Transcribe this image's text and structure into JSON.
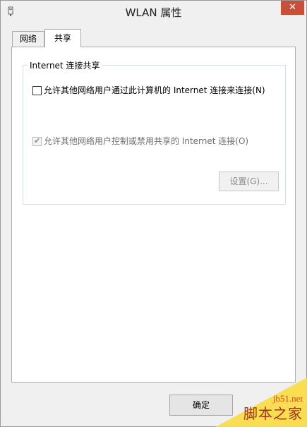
{
  "window": {
    "title": "WLAN 属性",
    "close_label": "✕"
  },
  "tabs": [
    {
      "label": "网络",
      "active": false
    },
    {
      "label": "共享",
      "active": true
    }
  ],
  "sharing": {
    "group_label": "Internet 连接共享",
    "allow_share": {
      "label": "允许其他网络用户通过此计算机的 Internet 连接来连接(N)",
      "checked": false,
      "enabled": true
    },
    "allow_control": {
      "label": "允许其他网络用户控制或禁用共享的 Internet 连接(O)",
      "checked": true,
      "enabled": false
    },
    "settings_button": "设置(G)..."
  },
  "footer": {
    "ok_label": "确定"
  },
  "watermark": {
    "url": "jb51.net",
    "name": "脚本之家"
  },
  "colors": {
    "close_button": "#c7503b",
    "watermark_fold": "#f9dc4a"
  }
}
